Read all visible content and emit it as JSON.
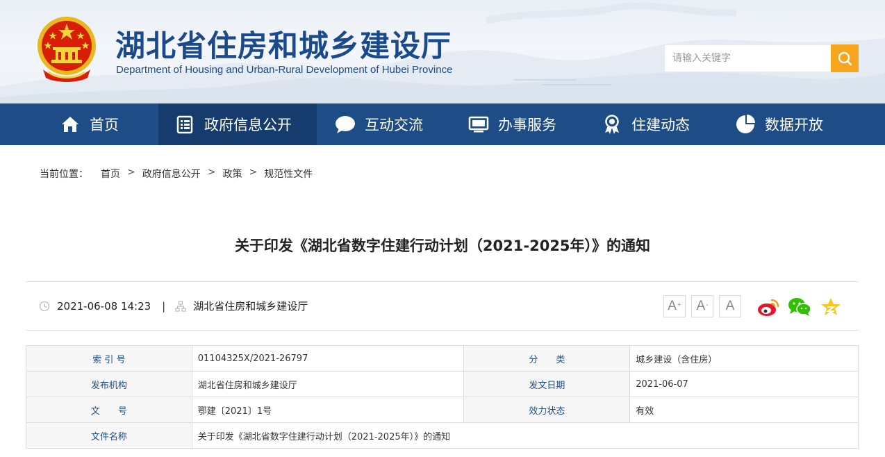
{
  "header": {
    "title": "湖北省住房和城乡建设厅",
    "subtitle": "Department of Housing and Urban-Rural Development of Hubei Province",
    "search_placeholder": "请输入关键字"
  },
  "nav": {
    "items": [
      {
        "label": "首页",
        "icon": "home-icon"
      },
      {
        "label": "政府信息公开",
        "icon": "document-list-icon"
      },
      {
        "label": "互动交流",
        "icon": "chat-bubble-icon"
      },
      {
        "label": "办事服务",
        "icon": "monitor-icon"
      },
      {
        "label": "住建动态",
        "icon": "award-ribbon-icon"
      },
      {
        "label": "数据开放",
        "icon": "pie-chart-icon"
      }
    ],
    "active_index": 1
  },
  "breadcrumb": {
    "label": "当前位置：",
    "items": [
      "首页",
      "政府信息公开",
      "政策",
      "规范性文件"
    ],
    "separator": ">"
  },
  "article": {
    "title": "关于印发《湖北省数字住建行动计划（2021-2025年）》的通知",
    "datetime": "2021-06-08 14:23",
    "divider": "|",
    "source": "湖北省住房和城乡建设厅"
  },
  "font_controls": {
    "increase": "A",
    "increase_sup": "+",
    "decrease": "A",
    "decrease_sup": "-",
    "reset": "A"
  },
  "share": [
    "weibo-icon",
    "wechat-icon",
    "qzone-icon"
  ],
  "info_table": {
    "rows": [
      {
        "k1": "索 引 号",
        "v1": "01104325X/2021-26797",
        "k2": "分　　类",
        "v2": "城乡建设（含住房）"
      },
      {
        "k1": "发布机构",
        "v1": "湖北省住房和城乡建设厅",
        "k2": "发文日期",
        "v2": "2021-06-07"
      },
      {
        "k1": "文　　号",
        "v1": "鄂建〔2021〕1号",
        "k2": "效力状态",
        "v2": "有效"
      }
    ],
    "name_row": {
      "k": "文件名称",
      "v": "关于印发《湖北省数字住建行动计划（2021-2025年）》的通知"
    }
  },
  "colors": {
    "brand_blue": "#1e4c86",
    "nav_active": "#163c6e",
    "search_button": "#f7a51c",
    "weibo_red": "#e6162d",
    "wechat_green": "#2dc100",
    "qzone_yellow": "#f8c51c"
  }
}
